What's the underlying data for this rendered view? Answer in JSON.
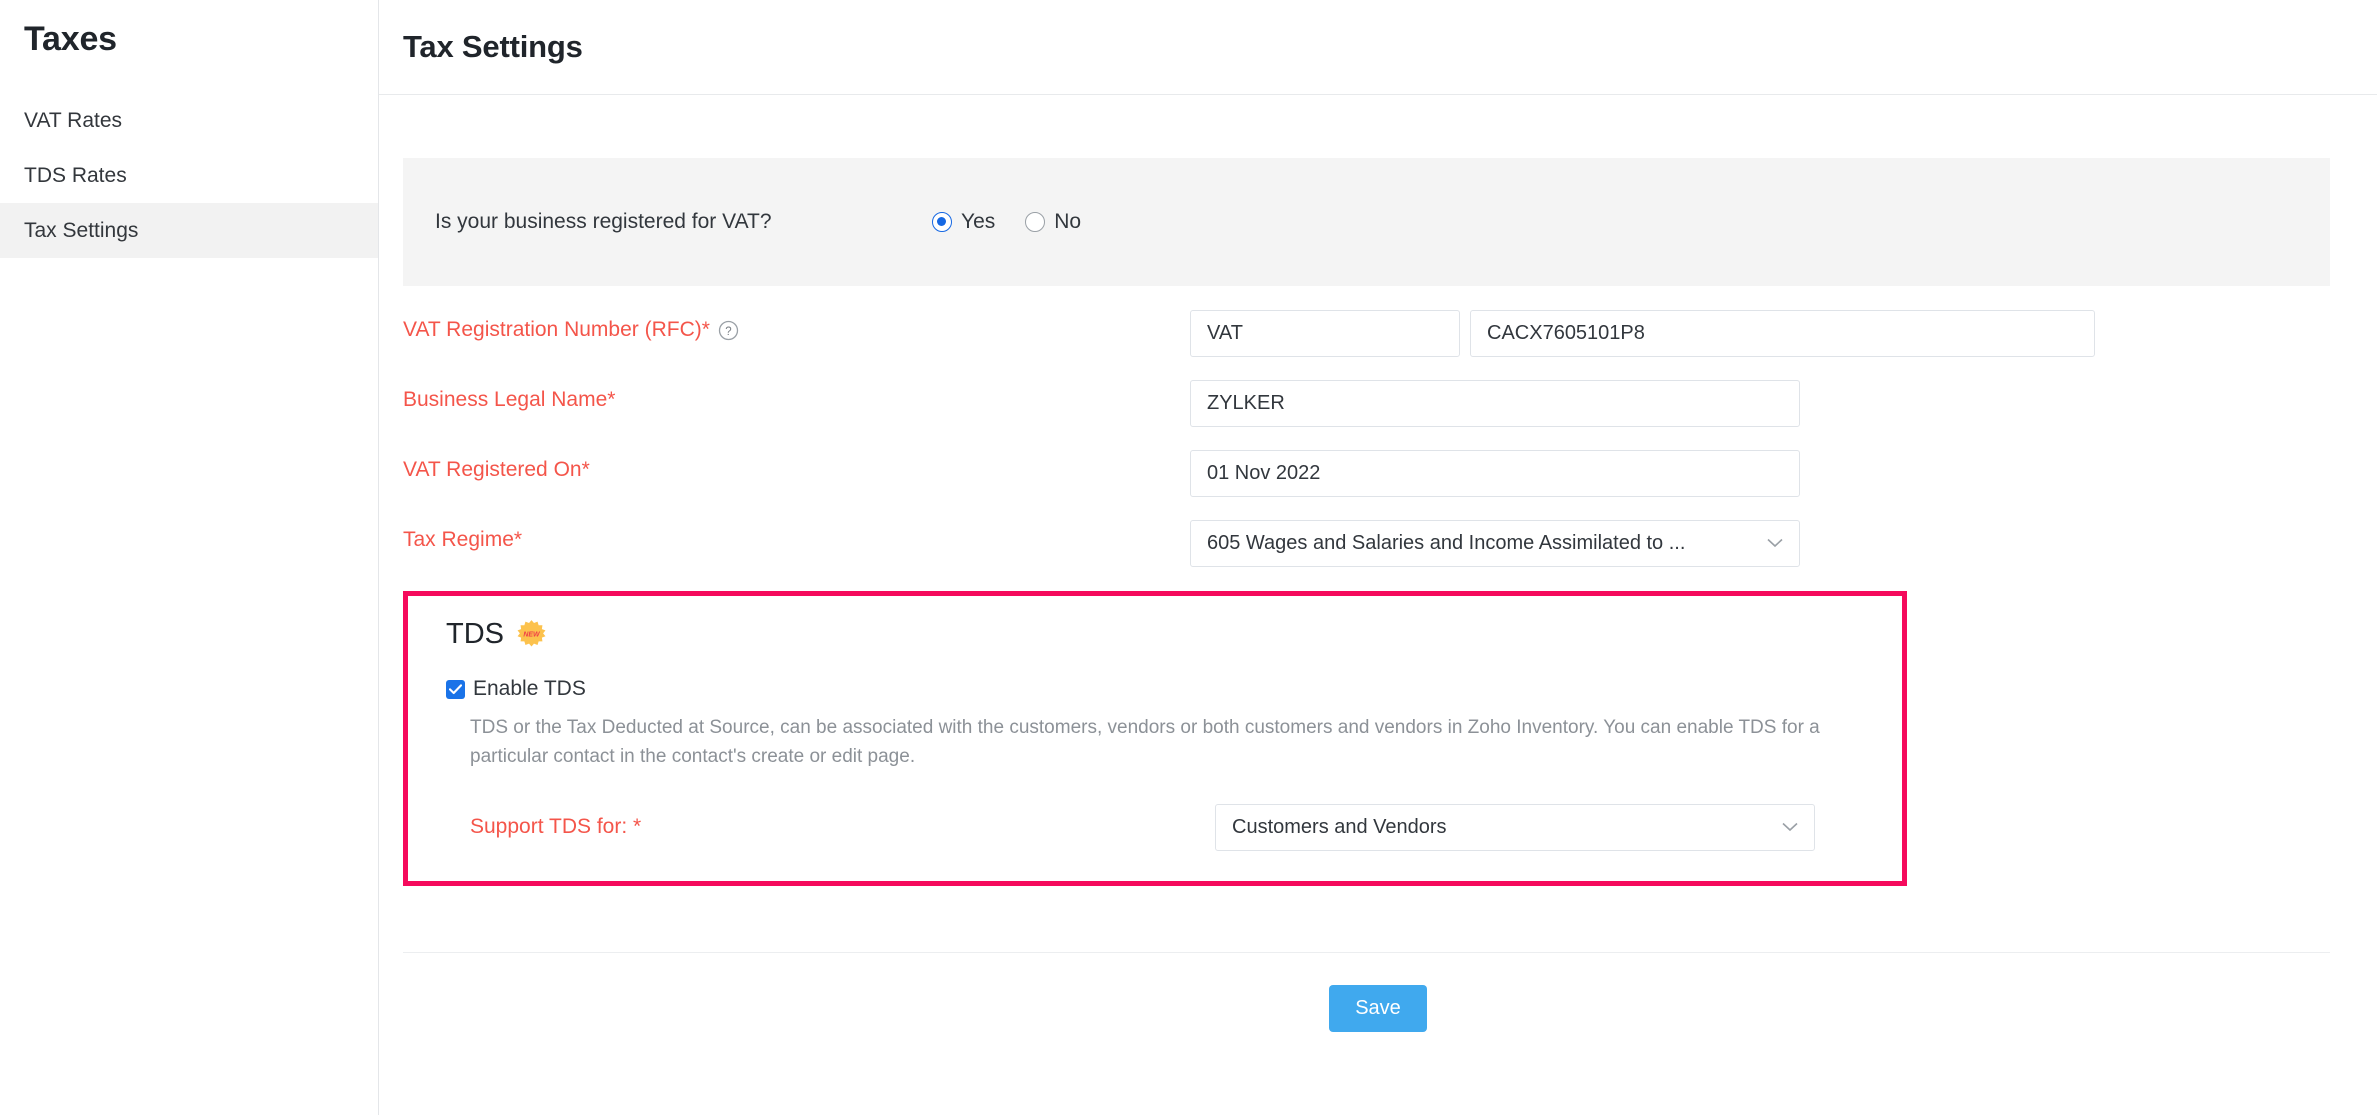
{
  "sidebar": {
    "title": "Taxes",
    "items": [
      {
        "label": "VAT Rates"
      },
      {
        "label": "TDS Rates"
      },
      {
        "label": "Tax Settings"
      }
    ]
  },
  "header": {
    "title": "Tax Settings"
  },
  "vat_question": {
    "label": "Is your business registered for VAT?",
    "options": [
      {
        "label": "Yes",
        "selected": true
      },
      {
        "label": "No",
        "selected": false
      }
    ]
  },
  "form": {
    "vat_registration_number": {
      "label": "VAT Registration Number (RFC)*",
      "help_icon": "help-circle-icon",
      "prefix_value": "VAT",
      "value": "CACX7605101P8"
    },
    "business_legal_name": {
      "label": "Business Legal Name*",
      "value": "ZYLKER"
    },
    "vat_registered_on": {
      "label": "VAT Registered On*",
      "value": "01 Nov 2022"
    },
    "tax_regime": {
      "label": "Tax Regime*",
      "value": "605 Wages and Salaries and Income Assimilated to ...",
      "chevron": "chevron-down-icon"
    }
  },
  "tds": {
    "title": "TDS",
    "badge": "NEW",
    "enable_label": "Enable TDS",
    "enable_checked": true,
    "description": "TDS or the Tax Deducted at Source, can be associated with the customers, vendors or both customers and vendors in Zoho Inventory. You can enable TDS for a particular contact in the contact's create or edit page.",
    "support_label": "Support TDS for: *",
    "support_value": "Customers and Vendors",
    "chevron": "chevron-down-icon",
    "highlight_color": "#f50a5c"
  },
  "footer": {
    "save_label": "Save",
    "save_color": "#40a9ee"
  }
}
